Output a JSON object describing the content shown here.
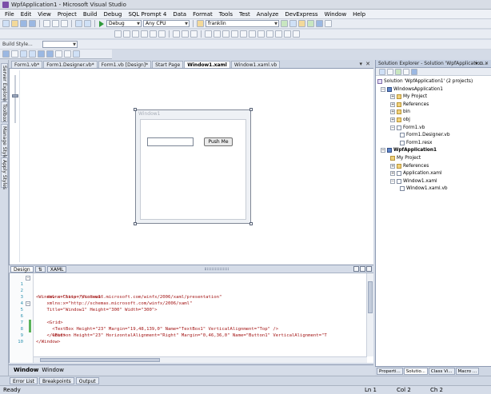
{
  "window": {
    "title": "WpfApplication1 - Microsoft Visual Studio"
  },
  "menu": [
    "File",
    "Edit",
    "View",
    "Project",
    "Build",
    "Debug",
    "SQL Prompt 4",
    "Data",
    "Format",
    "Tools",
    "Test",
    "Analyze",
    "DevExpress",
    "Window",
    "Help"
  ],
  "toolbar": {
    "config": "Debug",
    "platform": "Any CPU",
    "search": "franklin",
    "build_style": "Build Style..."
  },
  "left_tabs": [
    "Server Explorer",
    "Toolbox",
    "Manage Styles",
    "Apply Styles"
  ],
  "doc_tabs": [
    "Form1.vb*",
    "Form1.Designer.vb*",
    "Form1.vb [Design]*",
    "Start Page",
    "Window1.xaml",
    "Window1.xaml.vb"
  ],
  "designer": {
    "window_title": "Window1",
    "button_label": "Push Me"
  },
  "split": {
    "design_tab": "Design",
    "swap": "⇅",
    "xaml_tab": "XAML"
  },
  "code_lines": [
    {
      "n": "1",
      "text": "<Window x:Class=\"Window1\""
    },
    {
      "n": "2",
      "text": "    xmlns=\"http://schemas.microsoft.com/winfx/2006/xaml/presentation\""
    },
    {
      "n": "3",
      "text": "    xmlns:x=\"http://schemas.microsoft.com/winfx/2006/xaml\""
    },
    {
      "n": "4",
      "text": "    Title=\"Window1\" Height=\"300\" Width=\"300\">"
    },
    {
      "n": "5",
      "text": "    <Grid>"
    },
    {
      "n": "6",
      "text": "      <TextBox Height=\"23\" Margin=\"19,48,139,0\" Name=\"TextBox1\" VerticalAlignment=\"Top\" />"
    },
    {
      "n": "7",
      "text": "      <Button Height=\"23\" HorizontalAlignment=\"Right\" Margin=\"0,46,36,0\" Name=\"Button1\" VerticalAlignment=\"T"
    },
    {
      "n": "8",
      "text": "    </Grid>"
    },
    {
      "n": "9",
      "text": "</Window>"
    },
    {
      "n": "10",
      "text": ""
    }
  ],
  "breadcrumb": {
    "first": "Window",
    "second": "Window"
  },
  "bottom_tabs": [
    "Error List",
    "Breakpoints",
    "Output"
  ],
  "status": {
    "ready": "Ready",
    "ln": "Ln 1",
    "col": "Col 2",
    "ch": "Ch 2"
  },
  "solution_explorer": {
    "title": "Solution Explorer - Solution 'WpfApplication...",
    "ctrls": "▾ ⊐ ✕",
    "nodes": [
      {
        "label": "Solution 'WpfApplication1' (2 projects)",
        "x": 2,
        "icon": "sln",
        "exp": ""
      },
      {
        "label": "WindowsApplication1",
        "x": 6,
        "icon": "proj",
        "exp": "−"
      },
      {
        "label": "My Project",
        "x": 18,
        "icon": "folder",
        "exp": "+"
      },
      {
        "label": "References",
        "x": 18,
        "icon": "folder",
        "exp": "+"
      },
      {
        "label": "bin",
        "x": 18,
        "icon": "folder",
        "exp": "+"
      },
      {
        "label": "obj",
        "x": 18,
        "icon": "folder",
        "exp": "+"
      },
      {
        "label": "Form1.vb",
        "x": 18,
        "icon": "file",
        "exp": "−"
      },
      {
        "label": "Form1.Designer.vb",
        "x": 30,
        "icon": "file",
        "exp": ""
      },
      {
        "label": "Form1.resx",
        "x": 30,
        "icon": "file",
        "exp": ""
      },
      {
        "label": "WpfApplication1",
        "x": 6,
        "icon": "proj",
        "exp": "−",
        "bold": true
      },
      {
        "label": "My Project",
        "x": 18,
        "icon": "folder",
        "exp": ""
      },
      {
        "label": "References",
        "x": 18,
        "icon": "folder",
        "exp": "+"
      },
      {
        "label": "Application.xaml",
        "x": 18,
        "icon": "file",
        "exp": "+"
      },
      {
        "label": "Window1.xaml",
        "x": 18,
        "icon": "file",
        "exp": "−"
      },
      {
        "label": "Window1.xaml.vb",
        "x": 30,
        "icon": "file",
        "exp": ""
      }
    ],
    "tabs": [
      "Properti...",
      "Solutio...",
      "Class Vi...",
      "Macro ..."
    ]
  }
}
